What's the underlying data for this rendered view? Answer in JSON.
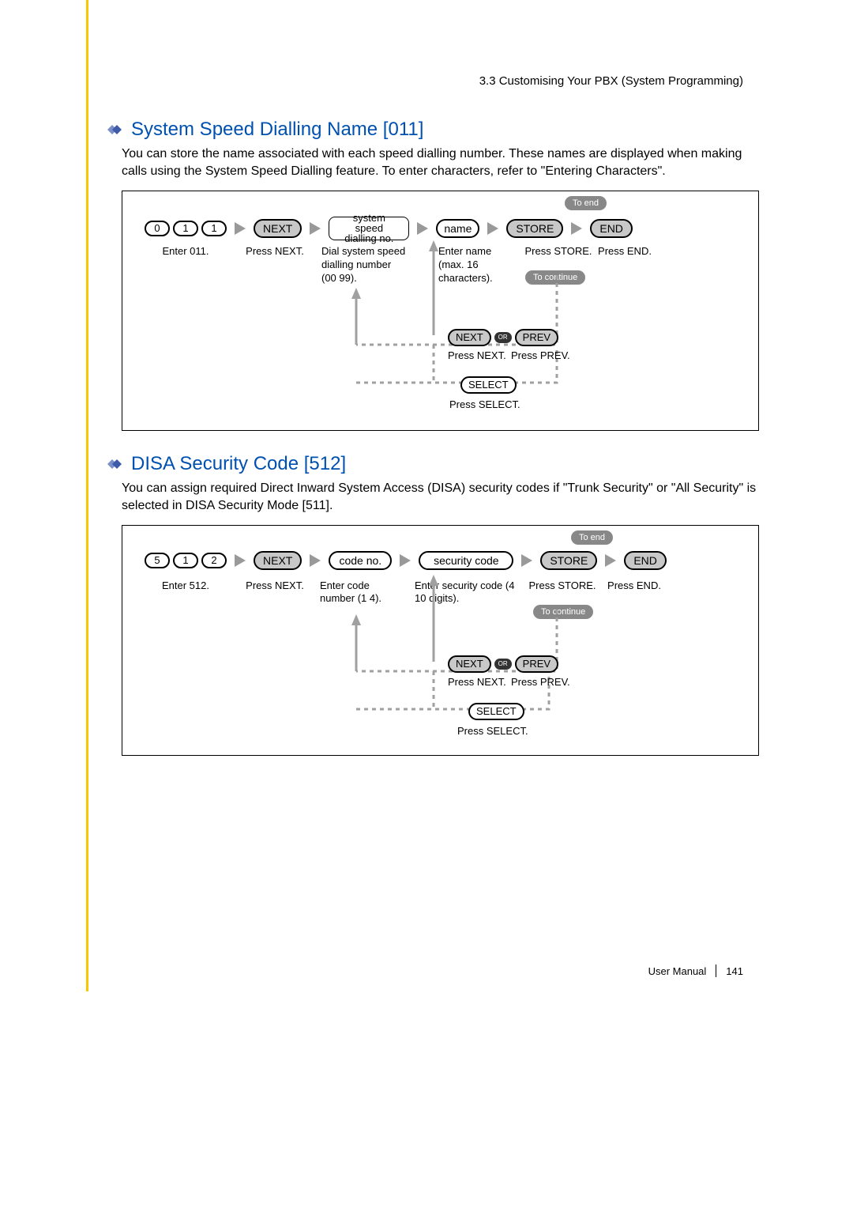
{
  "breadcrumb": "3.3 Customising Your PBX (System Programming)",
  "section1": {
    "title": "System Speed Dialling Name [011]",
    "body": "You can store the name associated with each speed dialling number. These names are displayed when making calls using the System Speed Dialling feature. To enter characters, refer to \"Entering Characters\".",
    "keys": [
      "0",
      "1",
      "1"
    ],
    "next_btn": "NEXT",
    "step2_box_l1": "system speed",
    "step2_box_l2": "dialling no.",
    "name_box": "name",
    "store_btn": "STORE",
    "end_btn": "END",
    "to_end": "To end",
    "to_continue": "To continue",
    "h1": "Enter 011.",
    "h2": "Press NEXT.",
    "h3": "Dial system speed dialling number  (00 99).",
    "h4": "Enter name (max. 16 characters).",
    "h5": "Press STORE.",
    "h6": "Press END.",
    "loop_next": "NEXT",
    "loop_prev": "PREV",
    "or": "OR",
    "loop_h1": "Press NEXT.",
    "loop_h2": "Press PREV.",
    "select_btn": "SELECT",
    "select_h": "Press SELECT."
  },
  "section2": {
    "title": "DISA Security Code [512]",
    "body": "You can assign required Direct Inward System Access (DISA) security codes if \"Trunk Security\" or \"All Security\" is selected in DISA Security Mode [511].",
    "keys": [
      "5",
      "1",
      "2"
    ],
    "next_btn": "NEXT",
    "step2_box": "code no.",
    "sec_box": "security code",
    "store_btn": "STORE",
    "end_btn": "END",
    "to_end": "To end",
    "to_continue": "To continue",
    "h1": "Enter 512.",
    "h2": "Press NEXT.",
    "h3": "Enter code number  (1 4).",
    "h4": "Enter security code (4 10 digits).",
    "h5": "Press STORE.",
    "h6": "Press END.",
    "loop_next": "NEXT",
    "loop_prev": "PREV",
    "or": "OR",
    "loop_h1": "Press NEXT.",
    "loop_h2": "Press PREV.",
    "select_btn": "SELECT",
    "select_h": "Press SELECT."
  },
  "footer": {
    "manual": "User Manual",
    "page": "141"
  }
}
